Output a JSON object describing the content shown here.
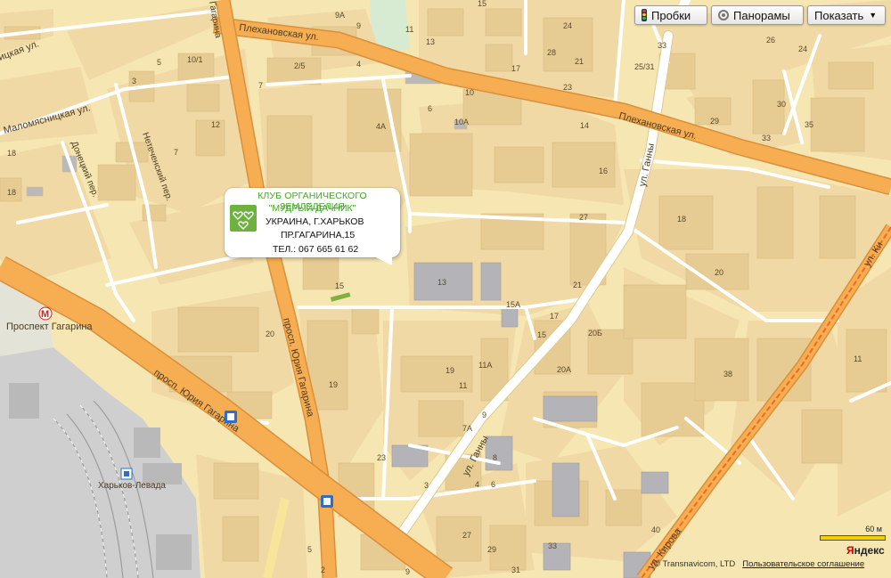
{
  "controls": {
    "traffic_label": "Пробки",
    "panoramas_label": "Панорамы",
    "show_label": "Показать"
  },
  "popup": {
    "title": "КЛУБ ОРГАНИЧЕСКОГО ЗЕМЛЕДЕЛИЯ",
    "subtitle": "\"МУДРЫЙ ДАЧНИК\"",
    "line1": "УКРАИНА, Г.ХАРЬКОВ",
    "line2": "ПР.ГАГАРИНА,15",
    "line3": "ТЕЛ.: 067 665 61 62"
  },
  "streets": {
    "plekhanovskaya": "Плехановская ул.",
    "gagarina_prosp": "просп. Юрия Гагарина",
    "gagarina_vert": "просп. Юрия Гагарина",
    "ganny_upper": "ул. Ганны",
    "ganny_lower": "ул. Ганны",
    "kirova": "ул. Кирова",
    "malomyasnitskaya": "Маломясницкая ул.",
    "donetsky": "Донецкий пер.",
    "netechensky": "Нетеченский пер.",
    "myasnitskaya": "ицкая ул.",
    "gagarina_short": "Гагарина",
    "kirova_short": "ул. Ки"
  },
  "places": {
    "metro_station": "Проспект Гагарина",
    "railway_station": "Харьков-Левада"
  },
  "house_numbers": {
    "h15_top": "15",
    "h9a": "9A",
    "h9": "9",
    "h11_top": "11",
    "h13_top": "13",
    "h10_1": "10/1",
    "h2_5": "2/5",
    "h4_top": "4",
    "h17_top": "17",
    "h10": "10",
    "h24": "24",
    "h33_top": "33",
    "h28": "28",
    "h21_top": "21",
    "h25_31": "25/31",
    "h26": "26",
    "h24b": "24",
    "h23": "23",
    "h27_top": "27",
    "h3": "3",
    "h12": "12",
    "h7": "7",
    "h18": "18",
    "h18b": "18",
    "h4a": "4A",
    "h6": "6",
    "h10a": "10A",
    "h14": "14",
    "h16": "16",
    "h29": "29",
    "h30": "30",
    "h33b": "33",
    "h35": "35",
    "h27": "27",
    "h17": "17",
    "h15": "15",
    "h13": "13",
    "h18c": "18",
    "h20": "20",
    "h21": "21",
    "h15a": "15A",
    "h17b": "17",
    "h15b": "15",
    "h20b": "20Б",
    "h20a": "20A",
    "h20c": "20",
    "h19": "19",
    "h11a": "11A",
    "h11": "11",
    "h9b": "9",
    "h7a": "7A",
    "h8": "8",
    "h4": "4",
    "h6b": "6",
    "h19b": "19",
    "h23b": "23",
    "h3b": "3",
    "h38": "38",
    "h11c": "11",
    "h27b": "27",
    "h29b": "29",
    "h31": "31",
    "h33c": "33",
    "h40": "40",
    "h5": "5",
    "h9c": "9",
    "h7b": "7",
    "h5b": "5",
    "h2": "2"
  },
  "attribution": {
    "copyright": "© Transnavicom, LTD",
    "terms": "Пользовательское соглашение"
  },
  "scale": {
    "label": "60 м"
  },
  "brand": {
    "first": "Я",
    "rest": "ндекс"
  },
  "colors": {
    "background": "#f6e6b2",
    "block": "#f2ddaa",
    "building": "#e8cf98",
    "major_road": "#f7ad52",
    "minor_road": "#ffffff",
    "railway_area": "#cfcfcf",
    "popup_title": "#4aa32d"
  }
}
